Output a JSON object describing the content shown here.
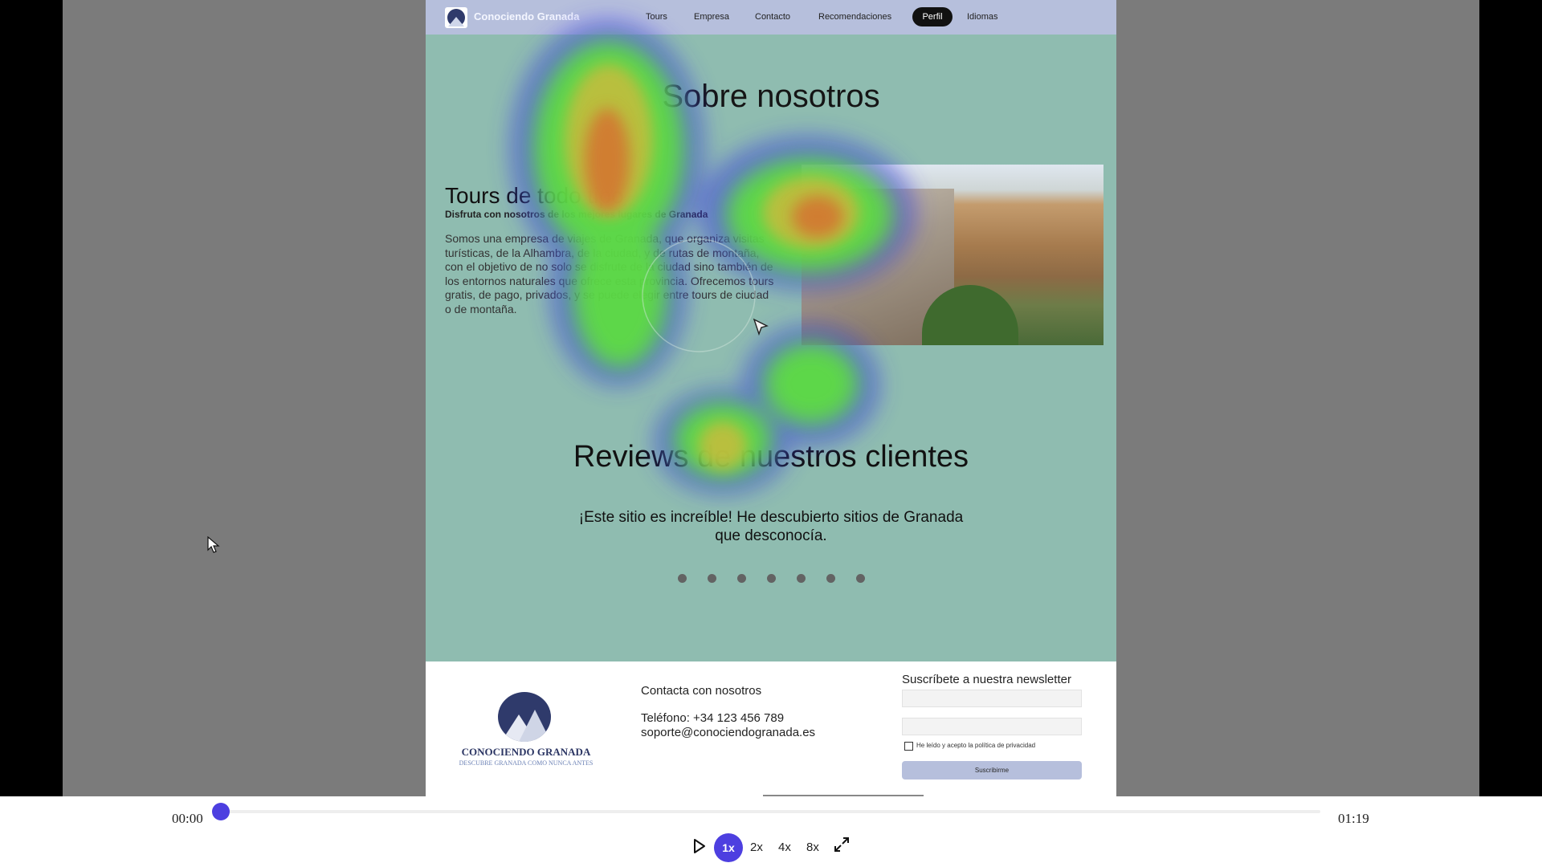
{
  "site": {
    "nav": {
      "brand": "Conociendo Granada",
      "links": [
        "Tours",
        "Empresa",
        "Contacto",
        "Recomendaciones",
        "Perfil",
        "Idiomas"
      ]
    },
    "about": {
      "title": "Sobre nosotros",
      "tours_title": "Tours de todo tipo",
      "tours_subtitle": "Disfruta con nosotros de los mejores lugares de Granada",
      "tours_body": "Somos una empresa de viajes de Granada, que organiza visitas turísticas, de la Alhambra, de la ciudad, y de rutas de montaña, con el objetivo de no solo se disfrute de la ciudad sino también de los entornos naturales que ofrece esta provincia. Ofrecemos tours gratis, de pago, privados, y se puede elegir entre tours de ciudad o de montaña."
    },
    "reviews": {
      "title": "Reviews de nuestros clientes",
      "text": "¡Este sitio es increíble! He descubierto sitios de Granada que desconocía.",
      "dot_count": 7
    },
    "footer": {
      "brand": "CONOCIENDO GRANADA",
      "tagline": "DESCUBRE GRANADA COMO NUNCA ANTES",
      "contact_title": "Contacta con nosotros",
      "phone": "Teléfono: +34 123 456 789",
      "email": "soporte@conociendogranada.es",
      "newsletter_title": "Suscríbete a nuestra newsletter",
      "privacy_label": "He leído y acepto la política de privacidad",
      "subscribe_label": "Suscribirme"
    }
  },
  "player": {
    "time_current": "00:00",
    "time_total": "01:19",
    "progress": 0,
    "speeds": [
      "1x",
      "2x",
      "4x",
      "8x"
    ],
    "active_speed": "1x"
  },
  "colors": {
    "accent": "#4d3fe0",
    "site_background": "#8fbcb0",
    "nav_background": "#b6bfdc",
    "letterbox_gray": "#7b7b7b"
  },
  "icons": [
    "play-icon",
    "fullscreen-icon",
    "cursor-icon"
  ]
}
